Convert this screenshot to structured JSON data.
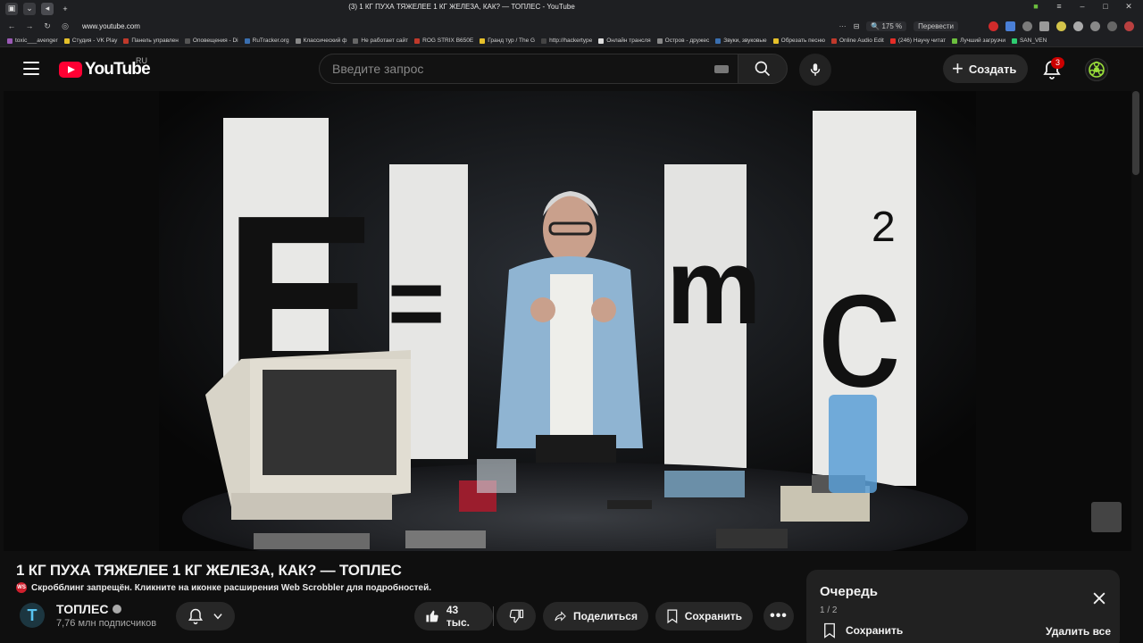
{
  "browser": {
    "tab_title": "(3) 1 КГ ПУХА ТЯЖЕЛЕЕ 1 КГ ЖЕЛЕЗА, КАК? — ТОПЛЕС - YouTube",
    "url": "www.youtube.com",
    "zoom": "175 %",
    "translate_label": "Перевести",
    "bookmarks": [
      "toxic___avenger",
      "Студия - VK Play",
      "Панель управлен",
      "Оповещения - Di",
      "RuTracker.org",
      "Классический ф",
      "Не работает сайт",
      "ROG STRIX B650E",
      "Гранд тур / The G",
      "http://hackertype",
      "Онлайн трансля",
      "Остров - дружес",
      "Звуки, звуковые",
      "Обрезать песню",
      "Online Audio Edit",
      "(246) Научу читат",
      "Лучший загрузчи",
      "SAN_VEN"
    ]
  },
  "header": {
    "logo_text": "YouTube",
    "region": "RU",
    "search_placeholder": "Введите запрос",
    "create_label": "Создать",
    "notification_count": "3"
  },
  "video": {
    "scene": {
      "letters": [
        "E",
        "=",
        "m",
        "c",
        "2"
      ]
    },
    "title": "1 КГ ПУХА ТЯЖЕЛЕЕ 1 КГ ЖЕЛЕЗА, КАК? — ТОПЛЕС",
    "scrobbler_icon": "WS",
    "scrobbler_notice": "Скробблинг запрещён. Кликните на иконке расширения Web Scrobbler для подробностей."
  },
  "channel": {
    "avatar_letter": "T",
    "name": "ТОПЛЕС",
    "subscribers": "7,76 млн подписчиков"
  },
  "actions": {
    "likes": "43 тыс.",
    "share_label": "Поделиться",
    "save_label": "Сохранить"
  },
  "queue": {
    "title": "Очередь",
    "count": "1 / 2",
    "save_label": "Сохранить",
    "clear_label": "Удалить все"
  },
  "colors": {
    "background": "#0f0f0f",
    "brand_red": "#ff0033",
    "button_bg": "#272727",
    "badge_red": "#cc0000"
  }
}
